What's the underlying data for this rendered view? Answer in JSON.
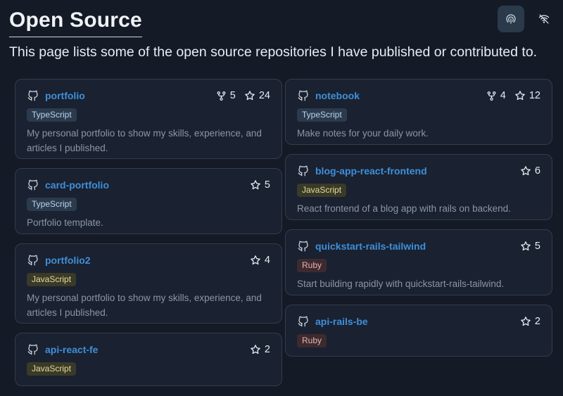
{
  "page": {
    "title": "Open Source",
    "subtitle": "This page lists some of the open source repositories I have published or contributed to."
  },
  "header": {
    "theme_icon": "fingerprint-icon",
    "wifi_icon": "wifi-off-icon"
  },
  "colors": {
    "background": "#141a26",
    "card_background": "#1a2130",
    "card_border": "#333d4b",
    "repo_link": "#3f8fd9",
    "description": "#8b96a4",
    "typescript_badge_bg": "#2b3b4d",
    "javascript_badge_bg": "#3a3a28",
    "ruby_badge_bg": "#3d2a2f"
  },
  "repos": {
    "portfolio": {
      "name": "portfolio",
      "forks": "5",
      "stars": "24",
      "language": "TypeScript",
      "description": "My personal portfolio to show my skills, experience, and articles I published."
    },
    "card_portfolio": {
      "name": "card-portfolio",
      "stars": "5",
      "language": "TypeScript",
      "description": "Portfolio template."
    },
    "portfolio2": {
      "name": "portfolio2",
      "stars": "4",
      "language": "JavaScript",
      "description": "My personal portfolio to show my skills, experience, and articles I published."
    },
    "api_react_fe": {
      "name": "api-react-fe",
      "stars": "2",
      "language": "JavaScript"
    },
    "notebook": {
      "name": "notebook",
      "forks": "4",
      "stars": "12",
      "language": "TypeScript",
      "description": "Make notes for your daily work."
    },
    "blog_app_react_frontend": {
      "name": "blog-app-react-frontend",
      "stars": "6",
      "language": "JavaScript",
      "description": "React frontend of a blog app with rails on backend."
    },
    "quickstart_rails_tailwind": {
      "name": "quickstart-rails-tailwind",
      "stars": "5",
      "language": "Ruby",
      "description": "Start building rapidly with quickstart-rails-tailwind."
    },
    "api_rails_be": {
      "name": "api-rails-be",
      "stars": "2",
      "language": "Ruby"
    }
  }
}
